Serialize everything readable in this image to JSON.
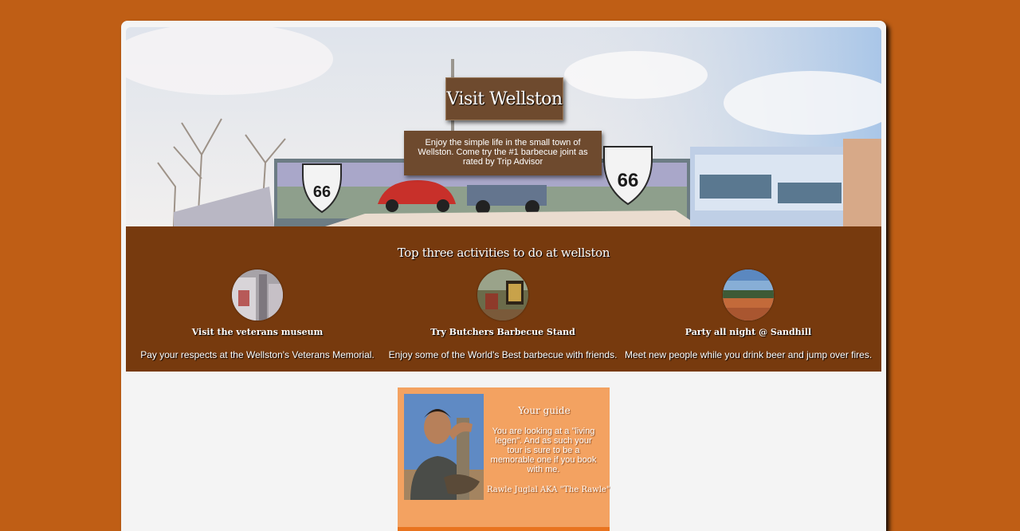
{
  "hero": {
    "title": "Visit Wellston",
    "description": "Enjoy the simple life in the small town of Wellston. Come try the #1 barbecue joint as rated by Trip Advisor"
  },
  "activities": {
    "heading": "Top three activities to do at wellston",
    "items": [
      {
        "title": "Visit the veterans museum",
        "text": "Pay your respects at the Wellston's Veterans Memorial."
      },
      {
        "title": "Try Butchers Barbecue Stand",
        "text": "Enjoy some of the World's Best barbecue with friends."
      },
      {
        "title": "Party all night @ Sandhill",
        "text": "Meet new people while you drink beer and jump over fires."
      }
    ]
  },
  "guide": {
    "heading": "Your guide",
    "text": "You are looking at a \"living legen\". And as such your tour is sure to be a memorable one if you book with me.",
    "signature": "Rawle Juglal AKA \"The Rawle\""
  },
  "colors": {
    "background": "#bf5e15",
    "activities_band": "#773a0e",
    "title_box": "#6e4a2e",
    "guide_card": "#f3a261"
  }
}
